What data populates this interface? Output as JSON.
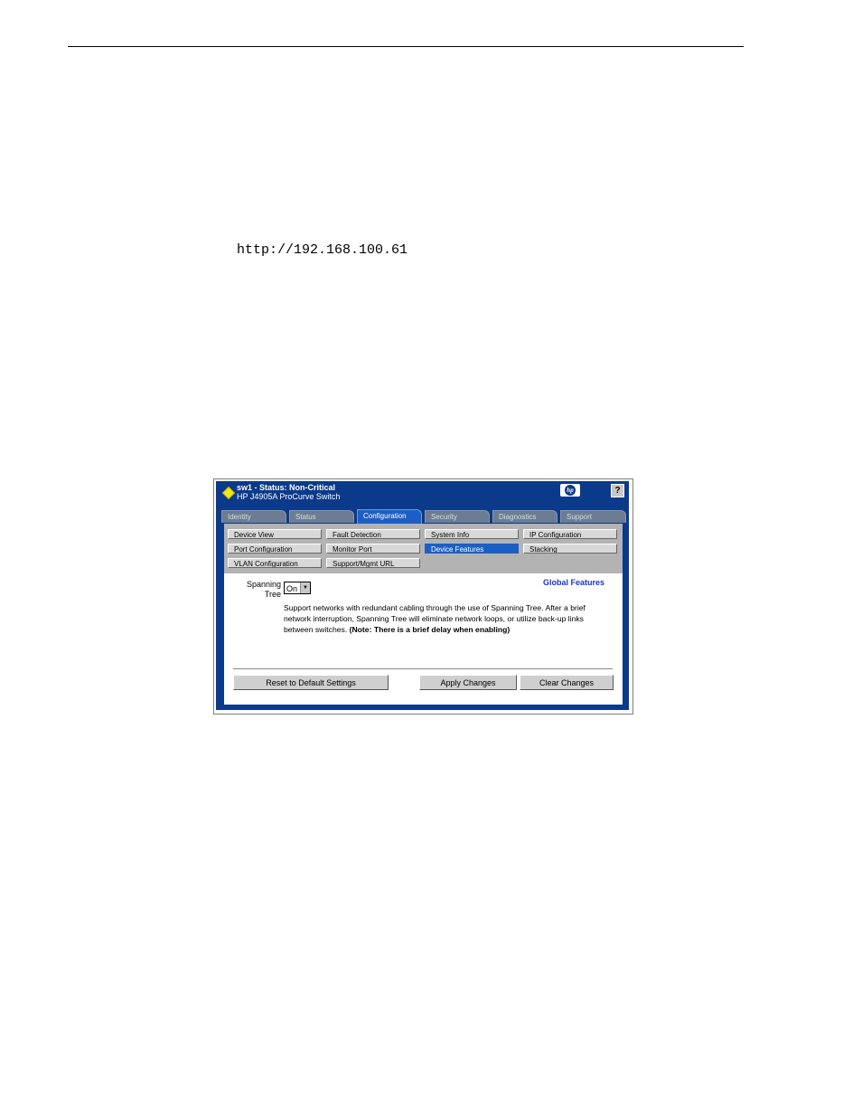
{
  "document": {
    "url": "http://192.168.100.61"
  },
  "header": {
    "device_status": "sw1 - Status: Non-Critical",
    "device_model": "HP J4905A ProCurve Switch",
    "help_label": "?"
  },
  "tabs": [
    {
      "label": "Identity"
    },
    {
      "label": "Status"
    },
    {
      "label": "Configuration"
    },
    {
      "label": "Security"
    },
    {
      "label": "Diagnostics"
    },
    {
      "label": "Support"
    }
  ],
  "subnav": [
    {
      "label": "Device View"
    },
    {
      "label": "Fault Detection"
    },
    {
      "label": "System Info"
    },
    {
      "label": "IP Configuration"
    },
    {
      "label": "Port Configuration"
    },
    {
      "label": "Monitor Port"
    },
    {
      "label": "Device Features"
    },
    {
      "label": "Stacking"
    },
    {
      "label": "VLAN Configuration"
    },
    {
      "label": "Support/Mgmt URL"
    }
  ],
  "content": {
    "spanning_tree_label_1": "Spanning",
    "spanning_tree_label_2": "Tree",
    "spanning_tree_value": "On",
    "section_title": "Global Features",
    "description": "Support networks with redundant cabling through the use of Spanning Tree. After a brief network interruption, Spanning Tree will eliminate network loops, or utilize back-up links between switches.",
    "note": "(Note: There is a brief delay when enabling)"
  },
  "actions": {
    "reset": "Reset to Default Settings",
    "apply": "Apply Changes",
    "clear": "Clear Changes"
  },
  "colors": {
    "brand_blue": "#0b3a8a",
    "active_tab": "#1c5fc4",
    "status_diamond": "#f7e619"
  }
}
